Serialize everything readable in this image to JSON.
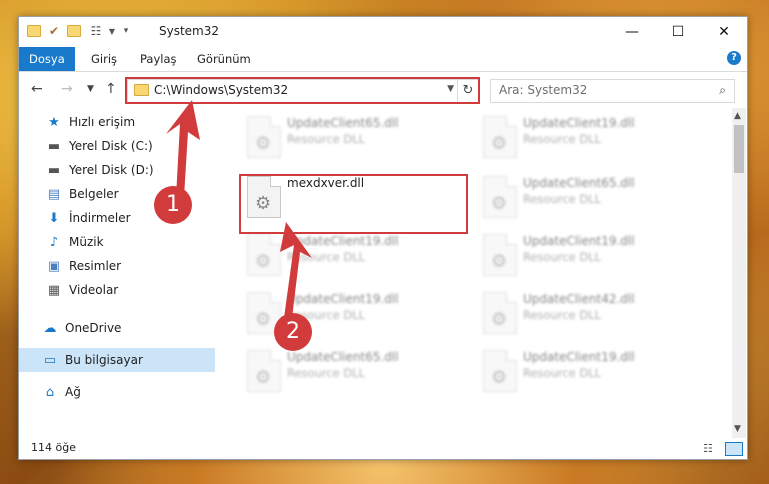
{
  "window": {
    "title": "System32"
  },
  "ribbon": {
    "tabs": [
      "Dosya",
      "Giriş",
      "Paylaş",
      "Görünüm"
    ]
  },
  "address": {
    "path": "C:\\Windows\\System32",
    "search_placeholder": "Ara: System32"
  },
  "nav": {
    "quick_access": "Hızlı erişim",
    "items": [
      {
        "label": "Yerel Disk (C:)",
        "icon": "drive-icon"
      },
      {
        "label": "Yerel Disk (D:)",
        "icon": "drive-icon"
      },
      {
        "label": "Belgeler",
        "icon": "documents-icon"
      },
      {
        "label": "İndirmeler",
        "icon": "downloads-icon"
      },
      {
        "label": "Müzik",
        "icon": "music-icon"
      },
      {
        "label": "Resimler",
        "icon": "pictures-icon"
      },
      {
        "label": "Videolar",
        "icon": "videos-icon"
      }
    ],
    "onedrive": "OneDrive",
    "this_pc": "Bu bilgisayar",
    "network": "Ağ"
  },
  "files": [
    {
      "name": "UpdateClient65.dll",
      "desc": "Resource DLL"
    },
    {
      "name": "UpdateClient19.dll",
      "desc": "Resource DLL"
    },
    {
      "name": "mexdxver.dll",
      "desc": ""
    },
    {
      "name": "UpdateClient65.dll",
      "desc": "Resource DLL"
    },
    {
      "name": "UpdateClient19.dll",
      "desc": "Resource DLL"
    },
    {
      "name": "UpdateClient19.dll",
      "desc": "Resource DLL"
    },
    {
      "name": "UpdateClient19.dll",
      "desc": "Resource DLL"
    },
    {
      "name": "UpdateClient42.dll",
      "desc": "Resource DLL"
    },
    {
      "name": "UpdateClient65.dll",
      "desc": "Resource DLL"
    },
    {
      "name": "UpdateClient19.dll",
      "desc": "Resource DLL"
    }
  ],
  "status": {
    "count": "114 öğe"
  },
  "callouts": [
    "1",
    "2"
  ],
  "colors": {
    "accent": "#1979ca",
    "highlight": "#d23b3b",
    "selected": "#cce4f7"
  }
}
